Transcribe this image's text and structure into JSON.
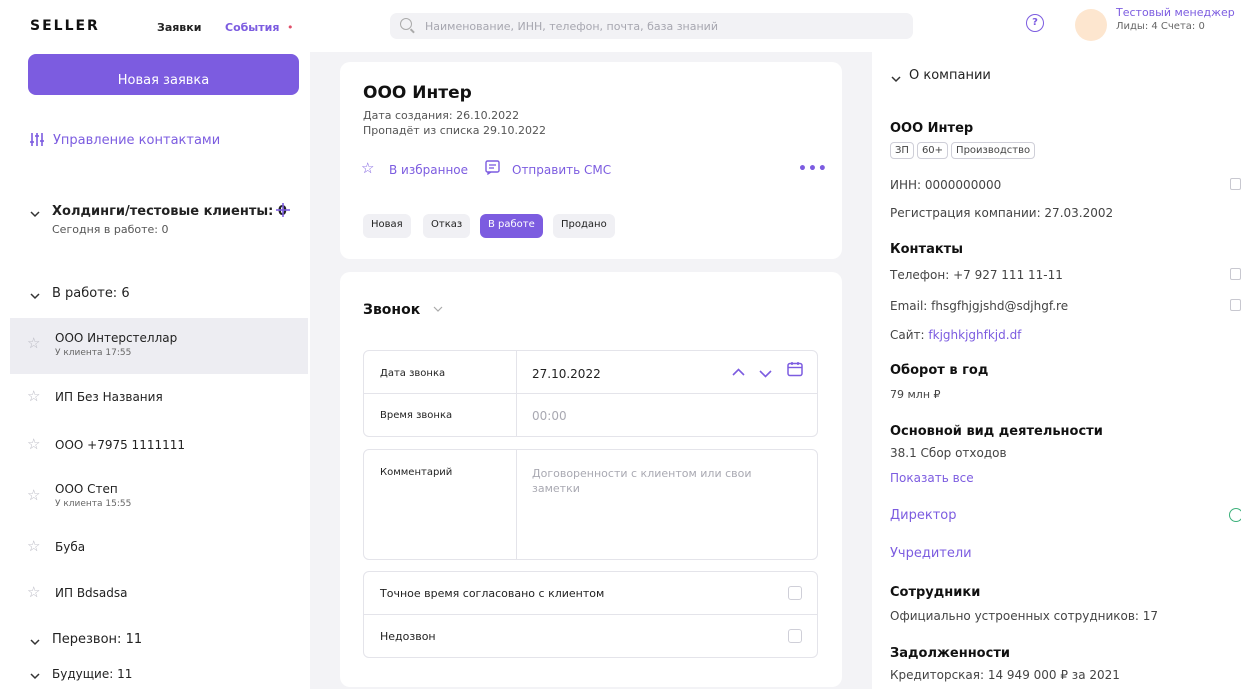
{
  "header": {
    "logo": "SELLER",
    "nav_requests": "Заявки",
    "nav_events": "События",
    "nav_events_dot": "•",
    "search_placeholder": "Наименование, ИНН, телефон, почта, база знаний",
    "help_icon_glyph": "?",
    "user_name": "Тестовый менеджер",
    "user_stats": "Лиды: 4 Счета: 0"
  },
  "sidebar": {
    "new_request": "Новая заявка",
    "manage_contacts": "Управление контактами",
    "holdings_title": "Холдинги/тестовые клиенты: 0",
    "holdings_sub": "Сегодня в работе: 0",
    "in_work_title": "В работе: 6",
    "items": [
      {
        "name": "ООО Интерстеллар",
        "sub": "У клиента 17:55"
      },
      {
        "name": "ИП Без Названия",
        "sub": ""
      },
      {
        "name": "ООО +7975 1111111",
        "sub": ""
      },
      {
        "name": "ООО Степ",
        "sub": "У клиента 15:55"
      },
      {
        "name": "Буба",
        "sub": ""
      },
      {
        "name": "ИП Bdsadsa",
        "sub": ""
      }
    ],
    "callback_title": "Перезвон: 11",
    "future_title": "Будущие: 11"
  },
  "card": {
    "company": "ООО Интер",
    "created": "Дата создания: 26.10.2022",
    "expires": "Пропадёт из списка 29.10.2022",
    "favorite": "В избранное",
    "send_sms": "Отправить СМС",
    "more": "•••",
    "statuses": [
      "Новая",
      "Отказ",
      "В работе",
      "Продано"
    ],
    "active_status": "В работе"
  },
  "call": {
    "title": "Звонок",
    "date_label": "Дата звонка",
    "date_value": "27.10.2022",
    "time_label": "Время звонка",
    "time_placeholder": "00:00",
    "comment_label": "Комментарий",
    "comment_placeholder": "Договоренности с клиентом или свои заметки",
    "exact_time": "Точное время согласовано с клиентом",
    "no_answer": "Недозвон"
  },
  "company": {
    "section_title": "О компании",
    "name": "ООО Интер",
    "tags": [
      "ЗП",
      "60+",
      "Производство"
    ],
    "inn": "ИНН: 0000000000",
    "registration": "Регистрация компании: 27.03.2002",
    "contacts_title": "Контакты",
    "phone": "Телефон: +7 927 111 11-11",
    "email": "Email: fhsgfhjgjshd@sdjhgf.re",
    "site_label": "Сайт: ",
    "site_value": "fkjghkjghfkjd.df",
    "turnover_title": "Оборот в год",
    "turnover_value": "79 млн ₽",
    "activity_title": "Основной вид деятельности",
    "activity_value": "38.1 Сбор отходов",
    "show_all": "Показать все",
    "director": "Директор",
    "founders": "Учредители",
    "employees_title": "Сотрудники",
    "employees_value": "Официально устроенных сотрудников: 17",
    "debts_title": "Задолженности",
    "debts_value": "Кредиторская: 14 949 000 ₽ за 2021"
  },
  "colors": {
    "accent": "#7c5ce0",
    "active_item_bg": "#ededf2",
    "page_bg": "#f3f3f6",
    "success": "#3bb07a"
  }
}
